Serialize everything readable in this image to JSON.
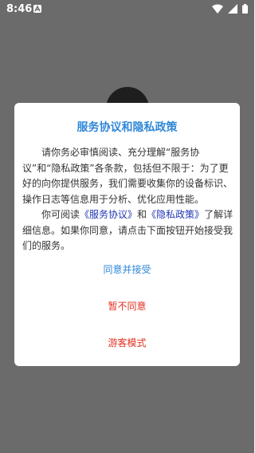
{
  "status_bar": {
    "time": "8:46",
    "icons": [
      "notification-a-icon",
      "wifi-icon",
      "signal-icon",
      "battery-icon"
    ]
  },
  "dialog": {
    "title": "服务协议和隐私政策",
    "paragraph1": "请你务必审慎阅读、充分理解“服务协议”和“隐私政策”各条款，包括但不限于：为了更好的向你提供服务，我们需要收集你的设备标识、操作日志等信息用于分析、优化应用性能。",
    "paragraph2_prefix": "你可阅读",
    "service_link": "《服务协议》",
    "paragraph2_and": "和",
    "privacy_link": "《隐私政策》",
    "paragraph2_suffix": "了解详细信息。如果你同意，请点击下面按钮开始接受我们的服务。",
    "agree_label": "同意并接受",
    "disagree_label": "暂不同意",
    "guest_label": "游客模式"
  },
  "colors": {
    "title": "#2f87d8",
    "link": "#2236b4",
    "agree": "#2f87d8",
    "disagree": "#e03020",
    "guest": "#e03020",
    "overlay": "#6b6b6b"
  }
}
